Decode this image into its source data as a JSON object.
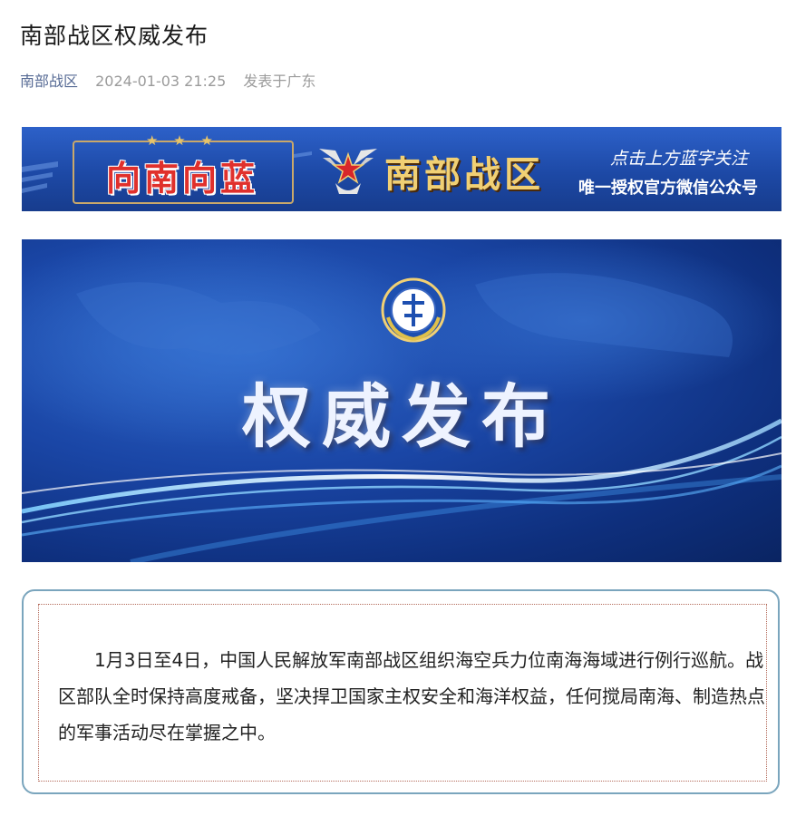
{
  "article": {
    "title": "南部战区权威发布",
    "account": "南部战区",
    "datetime": "2024-01-03 21:25",
    "location": "发表于广东"
  },
  "banner": {
    "slogan": "向南向蓝",
    "zone_name": "南部战区",
    "follow_hint": "点击上方蓝字关注",
    "official": "唯一授权官方微信公众号",
    "colors": {
      "background": "#1d49a6",
      "slogan": "#e0302c",
      "zone_name": "#f1d074"
    }
  },
  "hero": {
    "title": "权威发布",
    "badge_icon": "southern-theater-emblem"
  },
  "body": {
    "paragraph": "1月3日至4日，中国人民解放军南部战区组织海空兵力位南海海域进行例行巡航。战区部队全时保持高度戒备，坚决捍卫国家主权安全和海洋权益，任何搅局南海、制造热点的军事活动尽在掌握之中。"
  }
}
